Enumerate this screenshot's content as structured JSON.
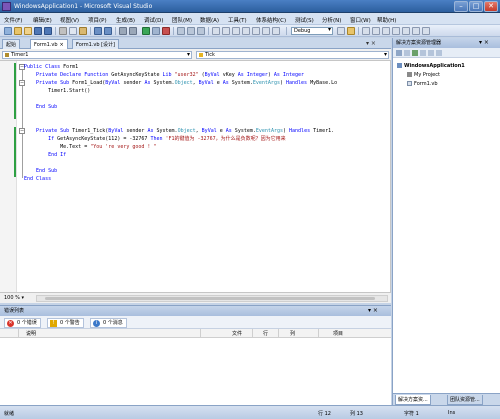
{
  "window": {
    "title": "WindowsApplication1 - Microsoft Visual Studio",
    "min_glyph": "–",
    "max_glyph": "□",
    "close_glyph": "✕"
  },
  "menu": [
    "文件(F)",
    "编辑(E)",
    "视图(V)",
    "项目(P)",
    "生成(B)",
    "调试(D)",
    "团队(M)",
    "数据(A)",
    "工具(T)",
    "体系结构(C)",
    "测试(S)",
    "分析(N)",
    "窗口(W)",
    "帮助(H)"
  ],
  "toolbar": {
    "config_value": "Debug"
  },
  "doc_tabs": [
    {
      "label": "起始",
      "active": false
    },
    {
      "label": "Form1.vb",
      "active": true
    },
    {
      "label": "Form1.vb [设计]",
      "active": false
    }
  ],
  "doc_tab_close": "×",
  "doc_tab_controls": "▾ ×",
  "nav": {
    "left_combo": "Timer1",
    "right_combo": "Tick"
  },
  "code_lines": [
    [
      {
        "t": "Public Class",
        "c": "kw"
      },
      {
        "t": " Form1",
        "c": "pl"
      }
    ],
    [
      {
        "t": "    Private Declare Function",
        "c": "kw"
      },
      {
        "t": " GetAsyncKeyState ",
        "c": "pl"
      },
      {
        "t": "Lib",
        "c": "kw"
      },
      {
        "t": " \"user32\" ",
        "c": "st"
      },
      {
        "t": "(",
        "c": "pl"
      },
      {
        "t": "ByVal",
        "c": "kw"
      },
      {
        "t": " vKey ",
        "c": "pl"
      },
      {
        "t": "As Integer",
        "c": "kw"
      },
      {
        "t": ") ",
        "c": "pl"
      },
      {
        "t": "As Integer",
        "c": "kw"
      }
    ],
    [
      {
        "t": "    Private Sub",
        "c": "kw"
      },
      {
        "t": " Form1_Load(",
        "c": "pl"
      },
      {
        "t": "ByVal",
        "c": "kw"
      },
      {
        "t": " sender ",
        "c": "pl"
      },
      {
        "t": "As",
        "c": "kw"
      },
      {
        "t": " System.",
        "c": "pl"
      },
      {
        "t": "Object",
        "c": "ty"
      },
      {
        "t": ", ",
        "c": "pl"
      },
      {
        "t": "ByVal",
        "c": "kw"
      },
      {
        "t": " e ",
        "c": "pl"
      },
      {
        "t": "As",
        "c": "kw"
      },
      {
        "t": " System.",
        "c": "pl"
      },
      {
        "t": "EventArgs",
        "c": "ty"
      },
      {
        "t": ") ",
        "c": "pl"
      },
      {
        "t": "Handles",
        "c": "kw"
      },
      {
        "t": " MyBase.Lo",
        "c": "pl"
      }
    ],
    [
      {
        "t": "        Timer1.Start()",
        "c": "pl"
      }
    ],
    [
      {
        "t": "",
        "c": "pl"
      }
    ],
    [
      {
        "t": "    End Sub",
        "c": "kw"
      }
    ],
    [
      {
        "t": "",
        "c": "pl"
      }
    ],
    [
      {
        "t": "",
        "c": "pl"
      }
    ],
    [
      {
        "t": "    Private Sub",
        "c": "kw"
      },
      {
        "t": " Timer1_Tick(",
        "c": "pl"
      },
      {
        "t": "ByVal",
        "c": "kw"
      },
      {
        "t": " sender ",
        "c": "pl"
      },
      {
        "t": "As",
        "c": "kw"
      },
      {
        "t": " System.",
        "c": "pl"
      },
      {
        "t": "Object",
        "c": "ty"
      },
      {
        "t": ", ",
        "c": "pl"
      },
      {
        "t": "ByVal",
        "c": "kw"
      },
      {
        "t": " e ",
        "c": "pl"
      },
      {
        "t": "As",
        "c": "kw"
      },
      {
        "t": " System.",
        "c": "pl"
      },
      {
        "t": "EventArgs",
        "c": "ty"
      },
      {
        "t": ") ",
        "c": "pl"
      },
      {
        "t": "Handles",
        "c": "kw"
      },
      {
        "t": " Timer1.",
        "c": "pl"
      }
    ],
    [
      {
        "t": "        If",
        "c": "kw"
      },
      {
        "t": " GetAsyncKeyState(112) = -32767 ",
        "c": "pl"
      },
      {
        "t": "Then",
        "c": "kw"
      },
      {
        "t": " 'F1的键值为 -32767，为什么是负数呢？因为它用来",
        "c": "st"
      }
    ],
    [
      {
        "t": "            Me.Text = ",
        "c": "pl"
      },
      {
        "t": "\"You 're very good ! \"",
        "c": "st"
      }
    ],
    [
      {
        "t": "        End If",
        "c": "kw"
      }
    ],
    [
      {
        "t": "",
        "c": "pl"
      }
    ],
    [
      {
        "t": "    End Sub",
        "c": "kw"
      }
    ],
    [
      {
        "t": "End Class",
        "c": "kw"
      }
    ]
  ],
  "zoom": "100 %",
  "error_list": {
    "title": "错误列表",
    "controls": "▾ ×",
    "filters": [
      {
        "label": "0 个错误",
        "icon": "error-icon",
        "color": "#d9342b",
        "glyph": "✕"
      },
      {
        "label": "0 个警告",
        "icon": "warning-icon",
        "color": "#e0a800",
        "glyph": "!"
      },
      {
        "label": "0 个消息",
        "icon": "info-icon",
        "color": "#3b78c9",
        "glyph": "i"
      }
    ],
    "columns": [
      "说明",
      "文件",
      "行",
      "列",
      "项目"
    ]
  },
  "solution_explorer": {
    "title": "解决方案资源管理器",
    "controls": "▾ ×",
    "tree": [
      {
        "label": "WindowsApplication1",
        "indent": 0,
        "bold": true,
        "icon": "project-icon"
      },
      {
        "label": "My Project",
        "indent": 1,
        "bold": false,
        "icon": "my-project-icon"
      },
      {
        "label": "Form1.vb",
        "indent": 1,
        "bold": false,
        "icon": "form-icon"
      }
    ],
    "bottom_tabs": [
      {
        "label": "解决方案资...",
        "active": true
      },
      {
        "label": "团队资源管...",
        "active": false
      }
    ]
  },
  "status": {
    "left": "就绪",
    "row": "行 12",
    "col": "列 13",
    "ch": "字符 1",
    "mode": "Ins"
  },
  "colors": {
    "accent": "#2c5f9e",
    "keyword": "#0000ff",
    "type": "#2b91af",
    "string": "#a31515",
    "changed": "#2ea043"
  }
}
